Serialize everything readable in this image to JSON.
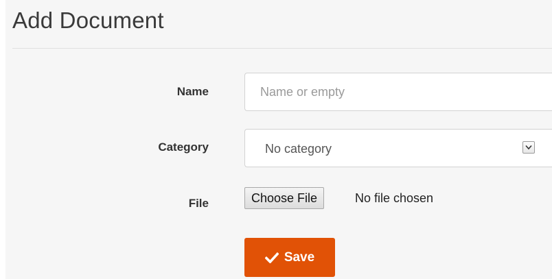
{
  "header": {
    "title": "Add Document"
  },
  "form": {
    "name": {
      "label": "Name",
      "value": "",
      "placeholder": "Name or empty"
    },
    "category": {
      "label": "Category",
      "selected": "No category"
    },
    "file": {
      "label": "File",
      "button_label": "Choose File",
      "status": "No file chosen"
    },
    "save": {
      "label": "Save",
      "icon": "check-icon"
    }
  },
  "colors": {
    "panel_background": "#f6f6f6",
    "save_button": "#e15206",
    "text": "#333333"
  }
}
